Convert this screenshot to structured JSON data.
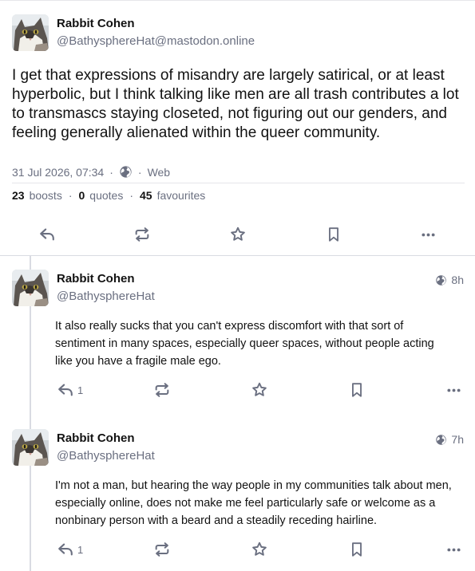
{
  "main_status": {
    "display_name": "Rabbit Cohen",
    "acct": "@BathysphereHat@mastodon.online",
    "content": "I get that expressions of misandry are largely satirical, or at least hyperbolic, but I think talking like men are all trash contributes a lot to transmascs staying closeted, not figuring out our genders, and feeling generally alienated within the queer community.",
    "timestamp": "31 Jul 2026, 07:34",
    "visibility_icon": "globe-icon",
    "application": "Web",
    "boosts_count": "23",
    "boosts_label": "boosts",
    "quotes_count": "0",
    "quotes_label": "quotes",
    "favourites_count": "45",
    "favourites_label": "favourites"
  },
  "replies": [
    {
      "display_name": "Rabbit Cohen",
      "acct": "@BathysphereHat",
      "time": "8h",
      "content": "It also really sucks that you can't express discomfort with that sort of sentiment in many spaces, especially queer spaces, without people acting like you have a fragile male ego.",
      "reply_count": "1"
    },
    {
      "display_name": "Rabbit Cohen",
      "acct": "@BathysphereHat",
      "time": "7h",
      "content": "I'm not a man, but hearing the way people in my communities talk about men, especially online, does not make me feel particularly safe or welcome as a nonbinary person with a beard and a steadily receding hairline.",
      "reply_count": "1"
    }
  ],
  "icons": {
    "reply": "reply-icon",
    "boost": "boost-icon",
    "favourite": "star-icon",
    "bookmark": "bookmark-icon",
    "more": "more-icon",
    "visibility": "globe-icon"
  },
  "colors": {
    "text": "#121212",
    "muted": "#6a6f80",
    "border": "#d9dbe2",
    "background": "#ffffff"
  }
}
